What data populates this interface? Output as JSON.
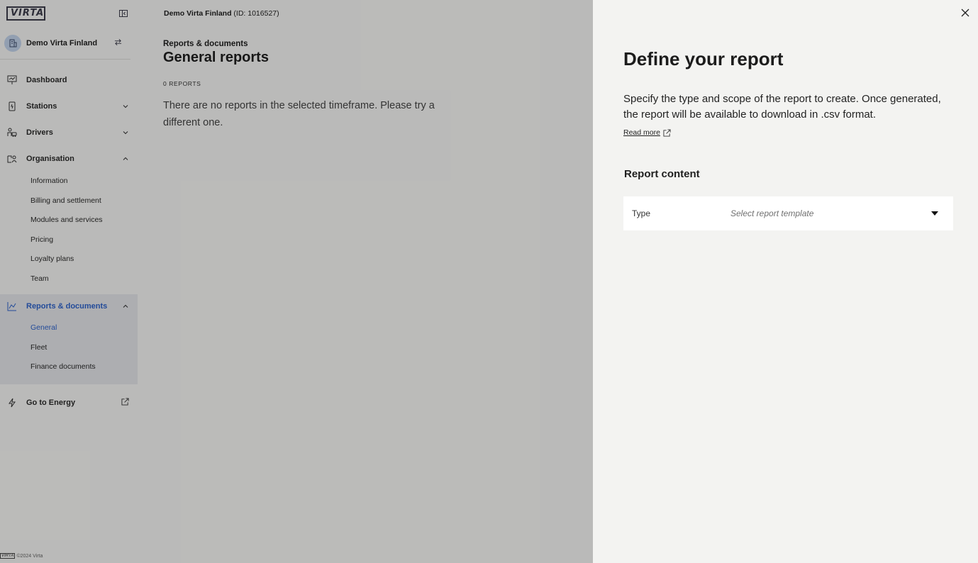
{
  "brand": {
    "logo_text": "VIRTA",
    "accent_color": "#2f63c9"
  },
  "sidebar": {
    "org_name": "Demo Virta Finland",
    "items": [
      {
        "label": "Dashboard",
        "icon": "dashboard-icon"
      },
      {
        "label": "Stations",
        "icon": "station-icon"
      },
      {
        "label": "Drivers",
        "icon": "drivers-icon"
      },
      {
        "label": "Organisation",
        "icon": "organisation-icon"
      }
    ],
    "organisation_sub": [
      "Information",
      "Billing and settlement",
      "Modules and services",
      "Pricing",
      "Loyalty plans",
      "Team"
    ],
    "reports": {
      "label": "Reports & documents",
      "icon": "chart-line-icon"
    },
    "reports_sub": [
      "General",
      "Fleet",
      "Finance documents"
    ],
    "energy": {
      "label": "Go to Energy",
      "icon": "lightning-icon"
    },
    "footer_logo": "VIRTA",
    "footer": "©2024 Virta"
  },
  "topbar": {
    "org_name": "Demo Virta Finland",
    "org_id": "(ID: 1016527)"
  },
  "main": {
    "breadcrumb": "Reports & documents",
    "title": "General reports",
    "count": "0 REPORTS",
    "empty_message": "There are no reports in the selected timeframe. Please try a different one."
  },
  "panel": {
    "title": "Define your report",
    "description": "Specify the type and scope of the report to create. Once generated, the report will be available to download in .csv format.",
    "read_more": "Read more",
    "section_title": "Report content",
    "type_label": "Type",
    "type_placeholder": "Select report template"
  }
}
